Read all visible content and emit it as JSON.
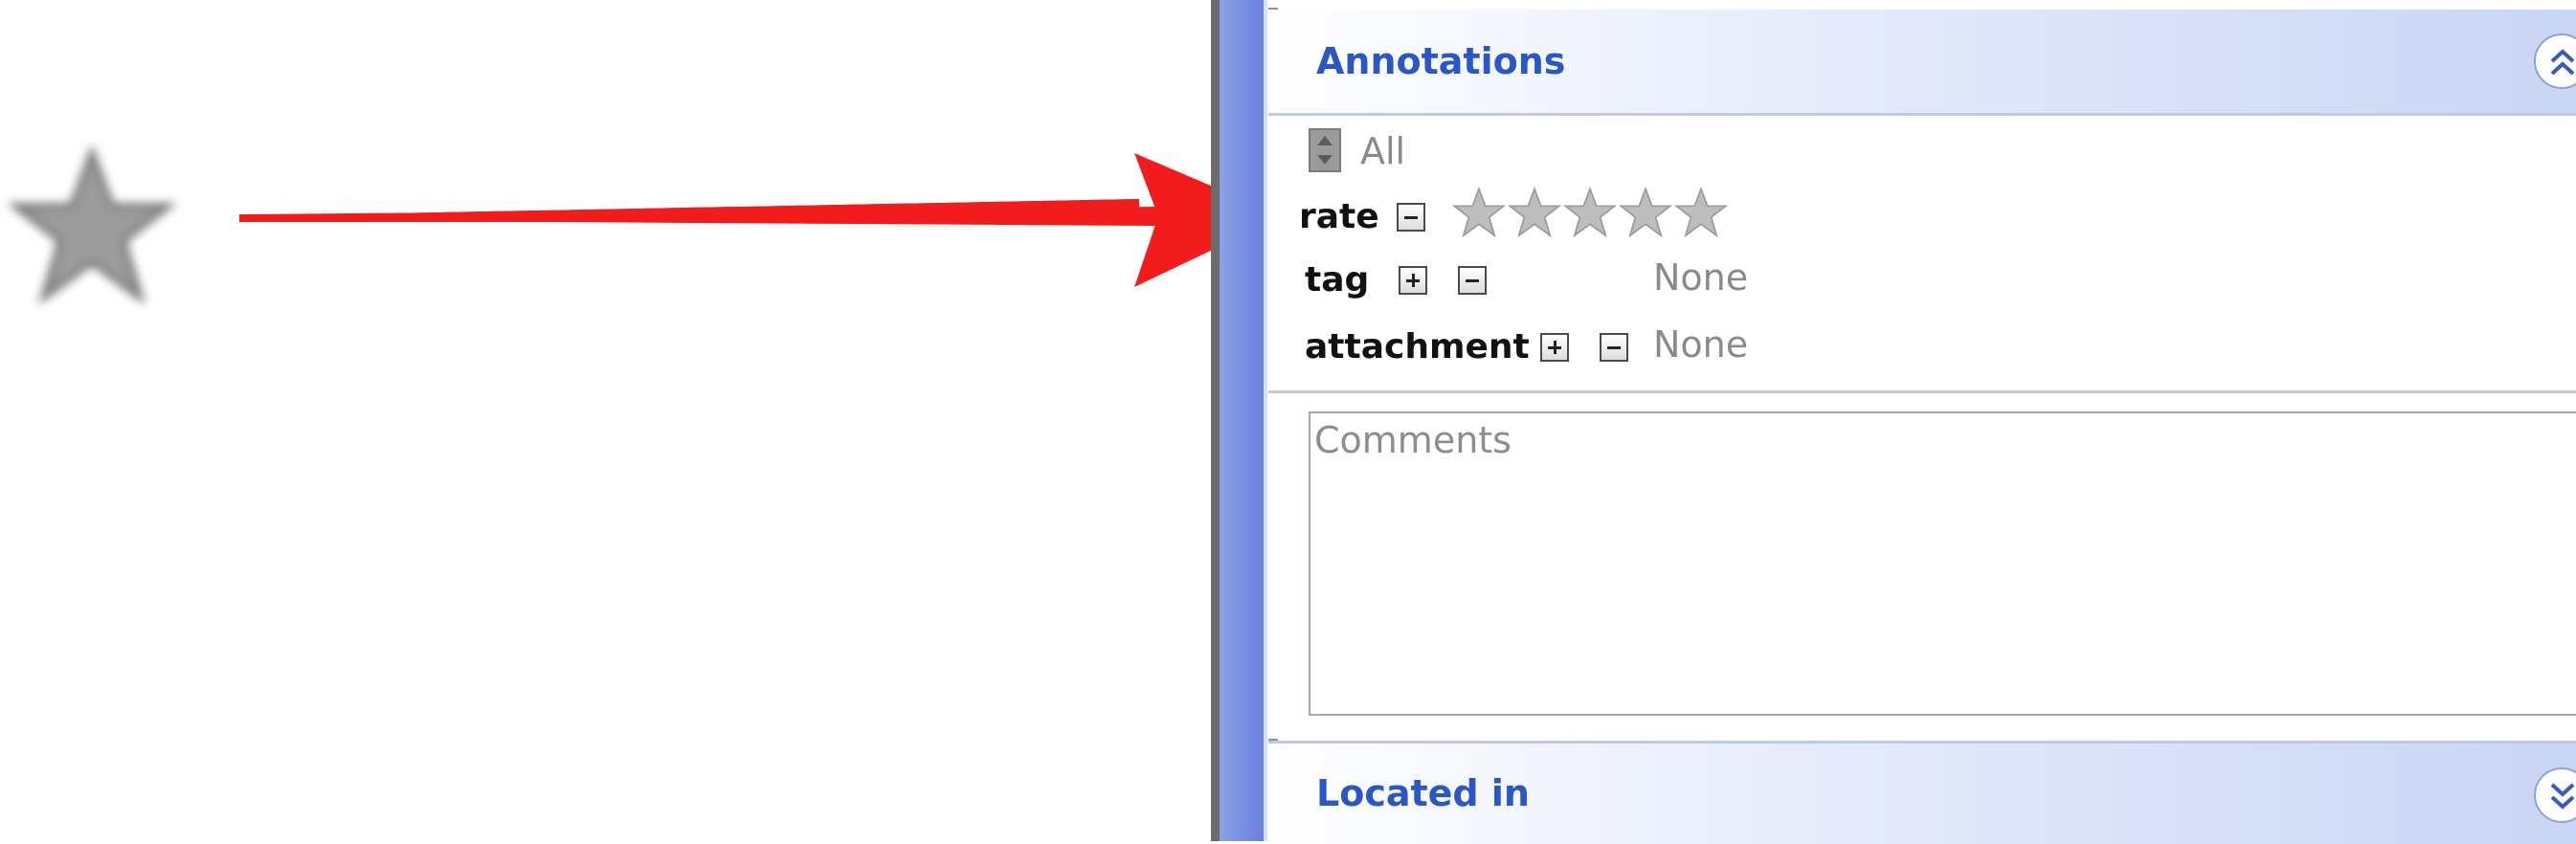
{
  "annotations_panel": {
    "title": "Annotations",
    "filter_label": "All",
    "rows": {
      "rate": {
        "label": "rate",
        "value": 0,
        "max": 5
      },
      "tag": {
        "label": "tag",
        "value": "None"
      },
      "attachment": {
        "label": "attachment",
        "value": "None"
      }
    },
    "comments_placeholder": "Comments"
  },
  "located_panel": {
    "title": "Located in"
  },
  "colors": {
    "arrow": "#f21c1c",
    "header_title": "#2a56c6",
    "sidebar_blue": "#6a80dd",
    "star_gray": "#b8b8b8"
  },
  "icons": {
    "rating_star": "star-icon",
    "collapse": "double-chevron-up-icon",
    "expand": "double-chevron-down-icon"
  }
}
